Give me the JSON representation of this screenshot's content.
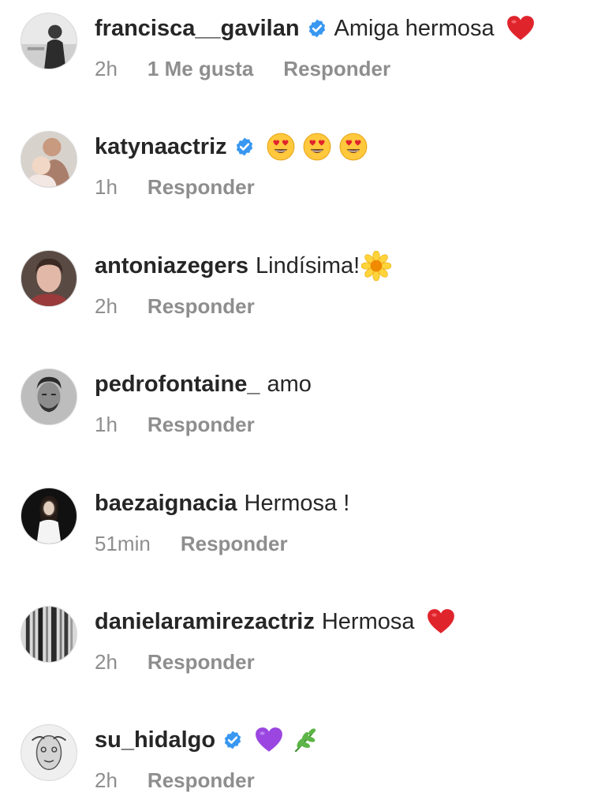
{
  "comments": [
    {
      "username": "francisca__gavilan",
      "verified": true,
      "text": "Amiga hermosa",
      "emojis": [
        "red-heart"
      ],
      "time": "2h",
      "likes": "1 Me gusta",
      "reply": "Responder"
    },
    {
      "username": "katynaactriz",
      "verified": true,
      "text": "",
      "emojis": [
        "heart-eyes",
        "heart-eyes",
        "heart-eyes"
      ],
      "time": "1h",
      "reply": "Responder"
    },
    {
      "username": "antoniazegers",
      "verified": false,
      "text": "Lindísima!",
      "emojis": [
        "sunflower"
      ],
      "time": "2h",
      "reply": "Responder"
    },
    {
      "username": "pedrofontaine_",
      "verified": false,
      "text": "amo",
      "emojis": [],
      "time": "1h",
      "reply": "Responder"
    },
    {
      "username": "baezaignacia",
      "verified": false,
      "text": "Hermosa !",
      "emojis": [],
      "time": "51min",
      "reply": "Responder"
    },
    {
      "username": "danielaramirezactriz",
      "verified": false,
      "text": "Hermosa",
      "emojis": [
        "red-heart"
      ],
      "time": "2h",
      "reply": "Responder"
    },
    {
      "username": "su_hidalgo",
      "verified": true,
      "text": "",
      "emojis": [
        "purple-heart",
        "herb"
      ],
      "time": "2h",
      "reply": "Responder"
    }
  ],
  "colors": {
    "text": "#262626",
    "meta": "#8e8e8e",
    "verified": "#3897f0",
    "red_heart": "#e0242c",
    "purple_heart": "#9b46e0"
  }
}
